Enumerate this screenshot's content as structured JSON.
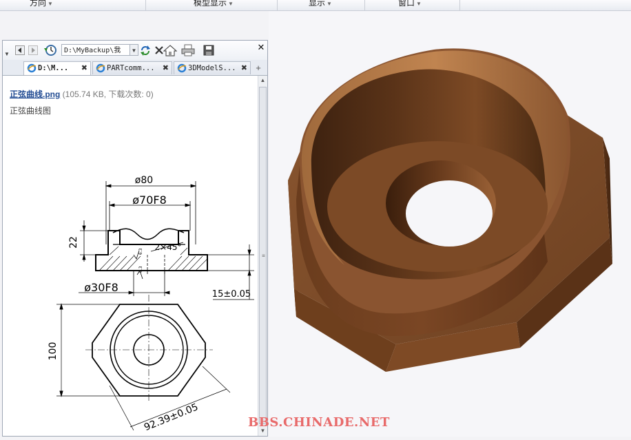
{
  "menubar": {
    "items": [
      {
        "label": "方向"
      },
      {
        "label": "模型显示"
      },
      {
        "label": "显示"
      },
      {
        "label": "窗口"
      }
    ]
  },
  "browser": {
    "address": "D:\\MyBackup\\我",
    "tabs": [
      {
        "label": "D:\\M...",
        "active": true
      },
      {
        "label": "PARTcomm...",
        "active": false
      },
      {
        "label": "3DModelS...",
        "active": false
      }
    ],
    "file": {
      "name": "正弦曲线.png",
      "meta": "(105.74 KB, 下载次数: 0)",
      "description": "正弦曲线图"
    }
  },
  "drawing": {
    "dim_outer_dia": "ø80",
    "dim_fit_dia": "ø70F8",
    "dim_height": "22",
    "dim_chamfer": "2×45°",
    "dim_hole": "ø30F8",
    "dim_thickness": "15±0.05",
    "dim_width": "100",
    "dim_across_flats": "92.39±0.05",
    "roughness_1": "6.3",
    "roughness_2": "6.3"
  },
  "watermark": "BBS.CHINADE.NET",
  "colors": {
    "model_top": "#7a4a27",
    "model_side": "#6b3e1f",
    "model_highlight": "#b47a4a",
    "link": "#224c93",
    "watermark": "#e86a6a"
  },
  "icons": [
    "back-icon",
    "forward-icon",
    "history-icon",
    "refresh-icon",
    "stop-icon",
    "home-icon",
    "print-icon",
    "save-icon",
    "close-icon",
    "ie-tab-icon"
  ]
}
